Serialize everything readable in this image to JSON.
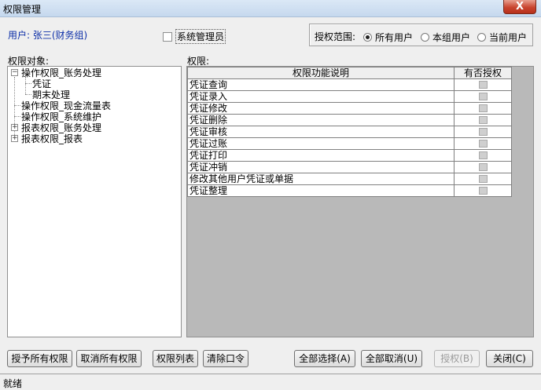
{
  "window": {
    "title": "权限管理",
    "close_glyph": "X"
  },
  "user": {
    "label": "用户: 张三(财务组)"
  },
  "system_admin": {
    "label": "系统管理员",
    "checked": false
  },
  "scope": {
    "label": "授权范围:",
    "options": [
      {
        "label": "所有用户",
        "selected": true
      },
      {
        "label": "本组用户",
        "selected": false
      },
      {
        "label": "当前用户",
        "selected": false
      }
    ]
  },
  "tree": {
    "label": "权限对象:",
    "items": [
      {
        "label": "操作权限_账务处理",
        "expander": "−"
      },
      {
        "label": "凭证"
      },
      {
        "label": "期末处理"
      },
      {
        "label": "操作权限_现金流量表"
      },
      {
        "label": "操作权限_系统维护"
      },
      {
        "label": "报表权限_账务处理",
        "expander": "+"
      },
      {
        "label": "报表权限_报表",
        "expander": "+"
      }
    ]
  },
  "grid": {
    "label": "权限:",
    "headers": {
      "function": "权限功能说明",
      "granted": "有否授权"
    },
    "rows": [
      {
        "function": "凭证查询",
        "granted": false
      },
      {
        "function": "凭证录入",
        "granted": false
      },
      {
        "function": "凭证修改",
        "granted": false
      },
      {
        "function": "凭证删除",
        "granted": false
      },
      {
        "function": "凭证审核",
        "granted": false
      },
      {
        "function": "凭证过账",
        "granted": false
      },
      {
        "function": "凭证打印",
        "granted": false
      },
      {
        "function": "凭证冲销",
        "granted": false
      },
      {
        "function": "修改其他用户凭证或单据",
        "granted": false
      },
      {
        "function": "凭证整理",
        "granted": false
      }
    ]
  },
  "buttons": {
    "grant_all": "授予所有权限",
    "revoke_all": "取消所有权限",
    "permission_list": "权限列表",
    "clear_password": "清除口令",
    "select_all": "全部选择(A)",
    "cancel_all": "全部取消(U)",
    "grant": "授权(B)",
    "close": "关闭(C)"
  },
  "status": {
    "text": "就绪"
  }
}
